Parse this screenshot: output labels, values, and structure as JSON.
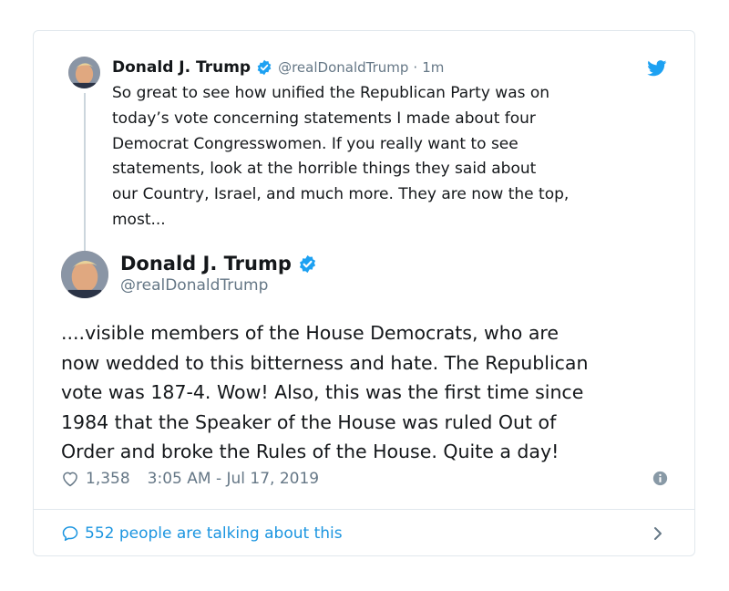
{
  "parent_tweet": {
    "name": "Donald J. Trump",
    "handle": "@realDonaldTrump",
    "separator": "·",
    "time": "1m",
    "text": "So great to see how unified the Republican Party was on\ntoday’s vote concerning statements I made about four\nDemocrat Congresswomen. If you really want to see\nstatements, look at the horrible things they said about\nour Country, Israel, and much more. They are now the top,\nmost..."
  },
  "main_tweet": {
    "name": "Donald J. Trump",
    "handle": "@realDonaldTrump",
    "text": "....visible members of the House Democrats, who are\nnow wedded to this bitterness and hate. The Republican\nvote was 187-4. Wow! Also, this was the first time since\n1984 that the Speaker of the House was ruled Out of\nOrder and broke the Rules of the House. Quite a day!",
    "likes": "1,358",
    "timestamp": "3:05 AM - Jul 17, 2019"
  },
  "footer": {
    "talking_label": "552 people are talking about this"
  },
  "icons": {
    "verified": "verified-badge-icon",
    "twitter": "twitter-bird-icon",
    "heart": "heart-icon",
    "info": "info-icon",
    "bubble": "speech-bubble-icon",
    "chevron": "chevron-right-icon"
  },
  "colors": {
    "accent": "#1da1f2",
    "link": "#1b95e0",
    "secondary_text": "#657786",
    "border": "#e1e8ed"
  }
}
